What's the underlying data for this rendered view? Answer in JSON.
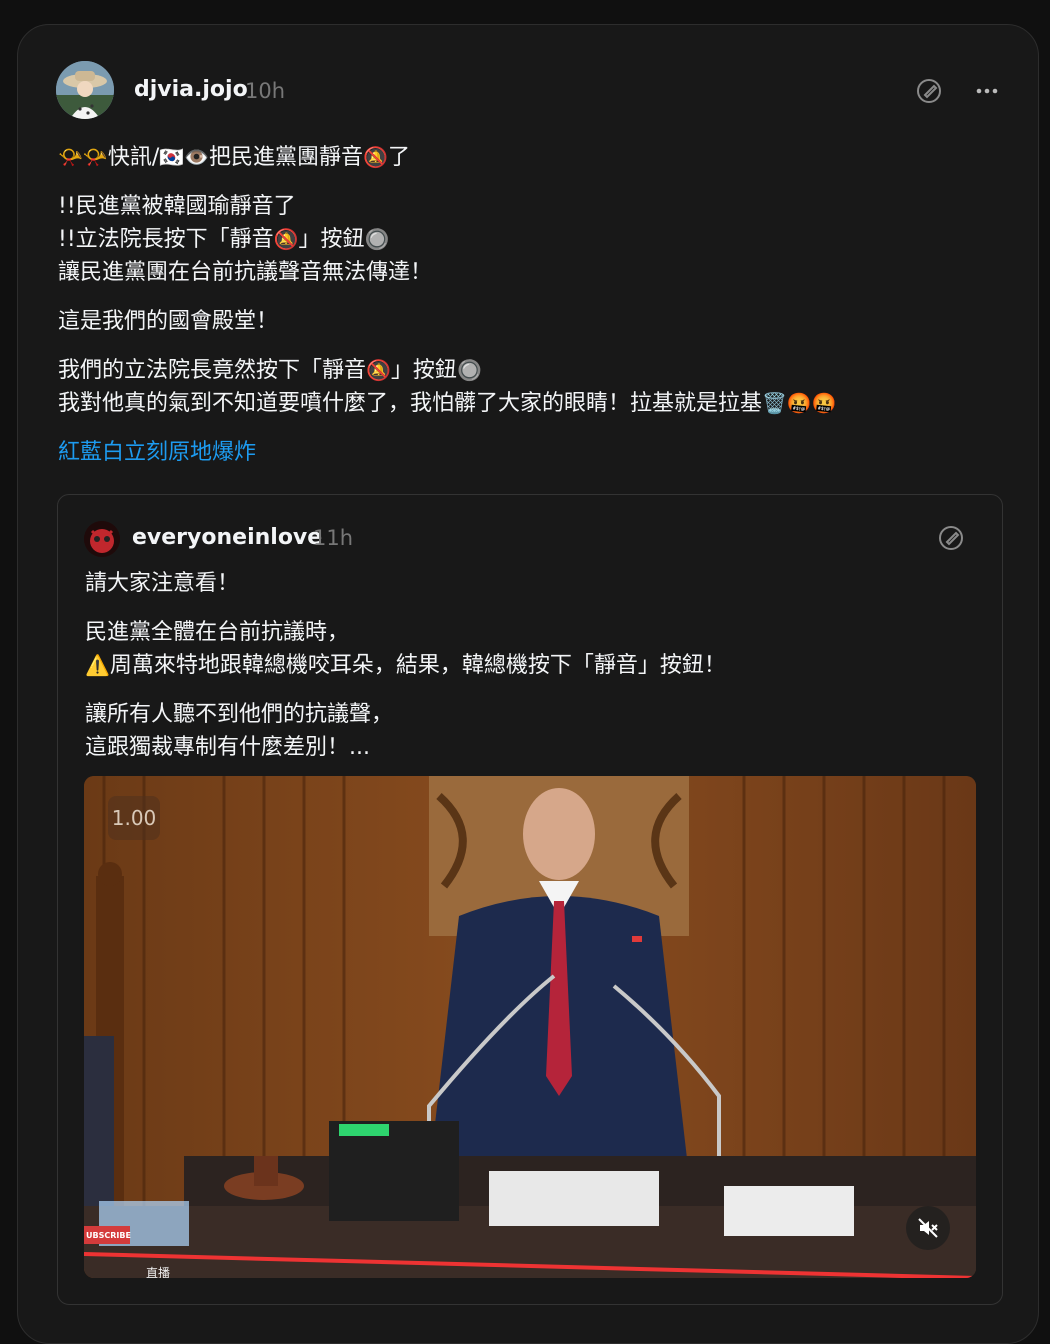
{
  "post": {
    "username": "djvia.jojo",
    "time": "10h",
    "lines": {
      "l1": "快訊/",
      "l1b": "把民進黨團靜音",
      "l1c": "了",
      "p2a": "!!民進黨被韓國瑜靜音了",
      "p2b_1": "!!立法院長按下「靜音",
      "p2b_2": "」按鈕",
      "p2c": "讓民進黨團在台前抗議聲音無法傳達！",
      "p3": "這是我們的國會殿堂！",
      "p4a_1": "我們的立法院長竟然按下「靜音",
      "p4a_2": "」按鈕",
      "p4b": "我對他真的氣到不知道要噴什麼了，我怕髒了大家的眼睛！拉基就是拉基"
    },
    "link_text": "紅藍白立刻原地爆炸"
  },
  "quote": {
    "username": "everyoneinlove",
    "time": "11h",
    "p1": "請大家注意看！",
    "p2a": "民進黨全體在台前抗議時，",
    "p2b": "周萬來特地跟韓總機咬耳朵，結果，韓總機按下「靜音」按鈕！",
    "p3a": "讓所有人聽不到他們的抗議聲，",
    "p3b": "這跟獨裁專制有什麼差別！..."
  },
  "video": {
    "speed_label": "1.00",
    "subscribe_label": "UBSCRIBE",
    "live_label": "直播"
  },
  "icons": {
    "header_action": "edit-quote-icon",
    "more": "more-icon",
    "mute": "muted-speaker-icon"
  }
}
